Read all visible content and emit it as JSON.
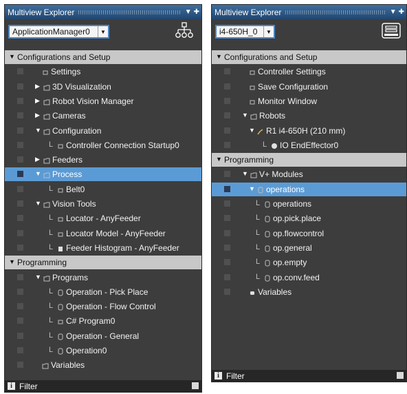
{
  "left": {
    "title": "Multiview Explorer",
    "combo_value": "ApplicationManager0",
    "toolbar_icon": "network-hierarchy-icon",
    "rows": [
      {
        "label": "Configurations and Setup",
        "header": true,
        "expander": "▼",
        "icon": "",
        "level": 0,
        "checkbox": false,
        "selected": false,
        "connector": false
      },
      {
        "label": "Settings",
        "header": false,
        "expander": "",
        "icon": "settings-icon",
        "level": 2,
        "checkbox": true,
        "selected": false,
        "connector": false
      },
      {
        "label": "3D Visualization",
        "header": false,
        "expander": "▶",
        "icon": "folder-icon",
        "level": 1,
        "checkbox": true,
        "selected": false,
        "connector": false
      },
      {
        "label": "Robot Vision Manager",
        "header": false,
        "expander": "▶",
        "icon": "folder-icon",
        "level": 1,
        "checkbox": true,
        "selected": false,
        "connector": false
      },
      {
        "label": "Cameras",
        "header": false,
        "expander": "▶",
        "icon": "folder-icon",
        "level": 1,
        "checkbox": true,
        "selected": false,
        "connector": false
      },
      {
        "label": "Configuration",
        "header": false,
        "expander": "▼",
        "icon": "folder-icon",
        "level": 1,
        "checkbox": true,
        "selected": false,
        "connector": false
      },
      {
        "label": "Controller Connection Startup0",
        "header": false,
        "expander": "",
        "icon": "startup-icon",
        "level": 3,
        "checkbox": true,
        "selected": false,
        "connector": true
      },
      {
        "label": "Feeders",
        "header": false,
        "expander": "▶",
        "icon": "folder-icon",
        "level": 1,
        "checkbox": true,
        "selected": false,
        "connector": false
      },
      {
        "label": "Process",
        "header": false,
        "expander": "▼",
        "icon": "folder-icon",
        "level": 1,
        "checkbox": true,
        "selected": true,
        "connector": false
      },
      {
        "label": "Belt0",
        "header": false,
        "expander": "",
        "icon": "belt-icon",
        "level": 3,
        "checkbox": true,
        "selected": false,
        "connector": true
      },
      {
        "label": "Vision Tools",
        "header": false,
        "expander": "▼",
        "icon": "folder-icon",
        "level": 1,
        "checkbox": true,
        "selected": false,
        "connector": false
      },
      {
        "label": "Locator - AnyFeeder",
        "header": false,
        "expander": "",
        "icon": "locator-icon",
        "level": 3,
        "checkbox": true,
        "selected": false,
        "connector": true
      },
      {
        "label": "Locator Model - AnyFeeder",
        "header": false,
        "expander": "",
        "icon": "locator-model-icon",
        "level": 3,
        "checkbox": true,
        "selected": false,
        "connector": true
      },
      {
        "label": "Feeder Histogram - AnyFeeder",
        "header": false,
        "expander": "",
        "icon": "histogram-icon",
        "level": 3,
        "checkbox": true,
        "selected": false,
        "connector": true
      },
      {
        "label": "Programming",
        "header": true,
        "expander": "▼",
        "icon": "",
        "level": 0,
        "checkbox": false,
        "selected": false,
        "connector": false
      },
      {
        "label": "Programs",
        "header": false,
        "expander": "▼",
        "icon": "folder-icon",
        "level": 1,
        "checkbox": true,
        "selected": false,
        "connector": false
      },
      {
        "label": "Operation - Pick Place",
        "header": false,
        "expander": "",
        "icon": "operation-icon",
        "level": 3,
        "checkbox": true,
        "selected": false,
        "connector": true
      },
      {
        "label": "Operation - Flow Control",
        "header": false,
        "expander": "",
        "icon": "operation-icon",
        "level": 3,
        "checkbox": true,
        "selected": false,
        "connector": true
      },
      {
        "label": "C# Program0",
        "header": false,
        "expander": "",
        "icon": "csharp-program-icon",
        "level": 3,
        "checkbox": true,
        "selected": false,
        "connector": true
      },
      {
        "label": "Operation - General",
        "header": false,
        "expander": "",
        "icon": "operation-icon",
        "level": 3,
        "checkbox": true,
        "selected": false,
        "connector": true
      },
      {
        "label": "Operation0",
        "header": false,
        "expander": "",
        "icon": "operation-icon",
        "level": 3,
        "checkbox": true,
        "selected": false,
        "connector": true
      },
      {
        "label": "Variables",
        "header": false,
        "expander": "",
        "icon": "folder-icon",
        "level": 2,
        "checkbox": true,
        "selected": false,
        "connector": false
      }
    ],
    "filter_label": "Filter"
  },
  "right": {
    "title": "Multiview Explorer",
    "combo_value": "i4-650H_0",
    "toolbar_icon": "controller-icon",
    "rows": [
      {
        "label": "Configurations and Setup",
        "header": true,
        "expander": "▼",
        "icon": "",
        "level": 0,
        "checkbox": false,
        "selected": false,
        "connector": false
      },
      {
        "label": "Controller Settings",
        "header": false,
        "expander": "",
        "icon": "controller-settings-icon",
        "level": 2,
        "checkbox": true,
        "selected": false,
        "connector": false
      },
      {
        "label": "Save Configuration",
        "header": false,
        "expander": "",
        "icon": "save-icon",
        "level": 2,
        "checkbox": true,
        "selected": false,
        "connector": false
      },
      {
        "label": "Monitor Window",
        "header": false,
        "expander": "",
        "icon": "monitor-icon",
        "level": 2,
        "checkbox": true,
        "selected": false,
        "connector": false
      },
      {
        "label": "Robots",
        "header": false,
        "expander": "▼",
        "icon": "folder-icon",
        "level": 1,
        "checkbox": true,
        "selected": false,
        "connector": false
      },
      {
        "label": "R1 i4-650H (210 mm)",
        "header": false,
        "expander": "▼",
        "icon": "robot-icon",
        "level": 2,
        "checkbox": true,
        "selected": false,
        "connector": false
      },
      {
        "label": "IO EndEffector0",
        "header": false,
        "expander": "",
        "icon": "end-effector-icon",
        "level": 4,
        "checkbox": true,
        "selected": false,
        "connector": true
      },
      {
        "label": "Programming",
        "header": true,
        "expander": "▼",
        "icon": "",
        "level": 0,
        "checkbox": false,
        "selected": false,
        "connector": false
      },
      {
        "label": "V+ Modules",
        "header": false,
        "expander": "▼",
        "icon": "folder-icon",
        "level": 1,
        "checkbox": true,
        "selected": false,
        "connector": false
      },
      {
        "label": "operations",
        "header": false,
        "expander": "▼",
        "icon": "module-icon",
        "level": 2,
        "checkbox": true,
        "selected": true,
        "connector": false
      },
      {
        "label": "operations",
        "header": false,
        "expander": "",
        "icon": "program-icon",
        "level": 3,
        "checkbox": true,
        "selected": false,
        "connector": true
      },
      {
        "label": "op.pick.place",
        "header": false,
        "expander": "",
        "icon": "program-icon",
        "level": 3,
        "checkbox": true,
        "selected": false,
        "connector": true
      },
      {
        "label": "op.flowcontrol",
        "header": false,
        "expander": "",
        "icon": "program-icon",
        "level": 3,
        "checkbox": true,
        "selected": false,
        "connector": true
      },
      {
        "label": "op.general",
        "header": false,
        "expander": "",
        "icon": "program-icon",
        "level": 3,
        "checkbox": true,
        "selected": false,
        "connector": true
      },
      {
        "label": "op.empty",
        "header": false,
        "expander": "",
        "icon": "program-icon",
        "level": 3,
        "checkbox": true,
        "selected": false,
        "connector": true
      },
      {
        "label": "op.conv.feed",
        "header": false,
        "expander": "",
        "icon": "program-icon",
        "level": 3,
        "checkbox": true,
        "selected": false,
        "connector": true
      },
      {
        "label": "Variables",
        "header": false,
        "expander": "",
        "icon": "variables-icon",
        "level": 2,
        "checkbox": true,
        "selected": false,
        "connector": false
      }
    ],
    "filter_label": "Filter"
  }
}
